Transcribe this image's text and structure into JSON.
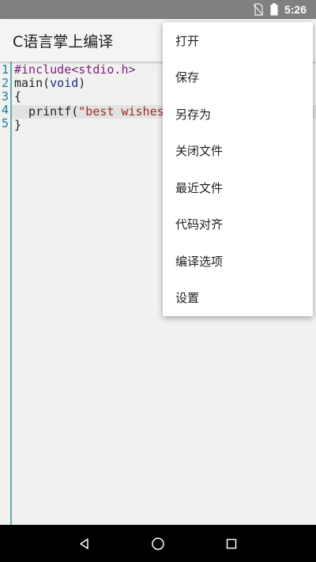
{
  "status_bar": {
    "time": "5:26",
    "icons": [
      "no-sim-icon",
      "battery-icon"
    ],
    "background": "#808080"
  },
  "app_bar": {
    "title": "C语言掌上编译"
  },
  "editor": {
    "line_numbers": [
      "1",
      "2",
      "3",
      "4",
      "5"
    ],
    "current_line": 4,
    "lines": [
      [
        {
          "type": "pre",
          "text": "#include<stdio.h>"
        }
      ],
      [
        {
          "type": "plain",
          "text": "main("
        },
        {
          "type": "kw",
          "text": "void"
        },
        {
          "type": "plain",
          "text": ")"
        }
      ],
      [
        {
          "type": "plain",
          "text": "{"
        }
      ],
      [
        {
          "type": "plain",
          "text": "  printf("
        },
        {
          "type": "str",
          "text": "\"best wishes"
        }
      ],
      [
        {
          "type": "plain",
          "text": "}"
        }
      ]
    ],
    "colors": {
      "preprocessor": "#7a1f7a",
      "keyword": "#1c2d8c",
      "string": "#a12a2a",
      "line_number": "#1a7f9a"
    }
  },
  "menu": {
    "items": [
      {
        "label": "打开"
      },
      {
        "label": "保存"
      },
      {
        "label": "另存为"
      },
      {
        "label": "关闭文件"
      },
      {
        "label": "最近文件"
      },
      {
        "label": "代码对齐"
      },
      {
        "label": "编译选项"
      },
      {
        "label": "设置"
      }
    ]
  },
  "nav_bar": {
    "buttons": [
      "back-icon",
      "home-icon",
      "recents-icon"
    ]
  }
}
